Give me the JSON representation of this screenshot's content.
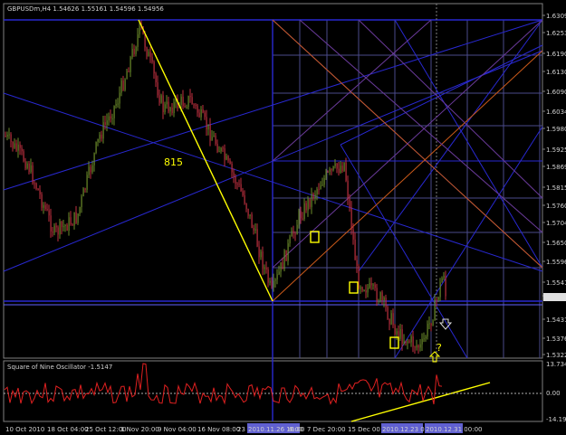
{
  "chart_title": "GBPUSDm,H4  1.54626 1.55161 1.54596 1.54956",
  "oscillator_title": "Square of Nine Oscillator -1.5147",
  "annotation_815": "815",
  "question_mark": "?",
  "colors": {
    "background": "#000000",
    "grid": "#4a4a8a",
    "blue_lines": "#2828d0",
    "yellow": "#ffff00",
    "orange": "#cc5a1a",
    "purple": "#6a3a9a",
    "candle_up": "#6d8c2a",
    "candle_down": "#c03040",
    "oscillator": "#e02020"
  },
  "price_axis": [
    "1.63090",
    "1.62535",
    "1.61905",
    "1.61305",
    "1.60900",
    "1.60345",
    "1.59805",
    "1.59250",
    "1.58695",
    "1.58155",
    "1.57600",
    "1.57045",
    "1.56505",
    "1.55965",
    "1.55410",
    "1.54956",
    "1.54315",
    "1.53760",
    "1.53220"
  ],
  "osc_axis": [
    "13.7346",
    "0.00",
    "-14.195"
  ],
  "time_axis": [
    "10 Oct 2010",
    "18 Oct 04:00",
    "25 Oct 12:00",
    "1 Nov 20:00",
    "9 Nov 04:00",
    "16 Nov 08:00",
    "23 No",
    "2010.11.26 16:00",
    "6:00",
    "7 Dec 20:00",
    "15 Dec 00",
    "2010.12.23 08:00",
    "2010.12.31 00:00"
  ]
}
